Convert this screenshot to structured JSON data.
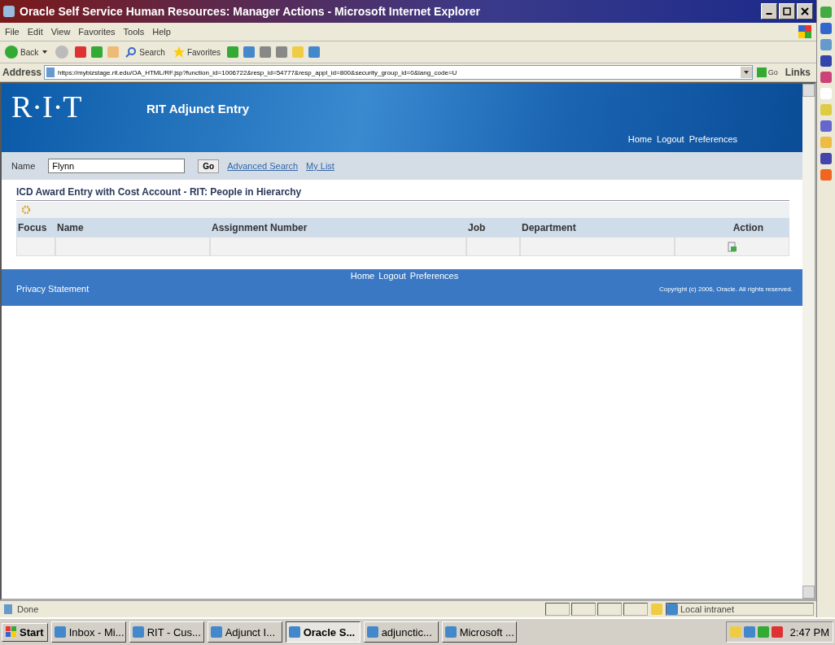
{
  "window": {
    "title": "Oracle Self Service Human Resources: Manager Actions - Microsoft Internet Explorer"
  },
  "menu": [
    "File",
    "Edit",
    "View",
    "Favorites",
    "Tools",
    "Help"
  ],
  "toolbar": {
    "back": "Back",
    "search": "Search",
    "favorites": "Favorites"
  },
  "address": {
    "label": "Address",
    "value": "https://mybizstage.rit.edu/OA_HTML/RF.jsp?function_id=1006722&resp_id=54777&resp_appl_id=800&security_group_id=0&lang_code=U",
    "go": "Go",
    "links": "Links"
  },
  "banner": {
    "logo": "R·I·T",
    "app_title": "RIT Adjunct Entry",
    "links": [
      "Home",
      "Logout",
      "Preferences"
    ]
  },
  "search": {
    "label": "Name",
    "value": "Flynn",
    "go": "Go",
    "links": [
      "Advanced Search",
      "My List"
    ]
  },
  "section_title": "ICD Award Entry with Cost Account - RIT: People in Hierarchy",
  "table": {
    "columns": [
      "Focus",
      "Name",
      "Assignment Number",
      "Job",
      "Department",
      "Action"
    ]
  },
  "footer": {
    "links": [
      "Home",
      "Logout",
      "Preferences"
    ],
    "privacy": "Privacy Statement",
    "copyright": "Copyright (c) 2006, Oracle. All rights reserved."
  },
  "status_bar": {
    "text": "Done",
    "zone": "Local intranet"
  },
  "taskbar": {
    "start": "Start",
    "tasks": [
      {
        "label": "Inbox - Mi...",
        "selected": false
      },
      {
        "label": "RIT - Cus...",
        "selected": false
      },
      {
        "label": "Adjunct I...",
        "selected": false
      },
      {
        "label": "Oracle S...",
        "selected": true
      },
      {
        "label": "adjunctic...",
        "selected": false
      },
      {
        "label": "Microsoft ...",
        "selected": false
      }
    ],
    "clock": "2:47 PM"
  }
}
